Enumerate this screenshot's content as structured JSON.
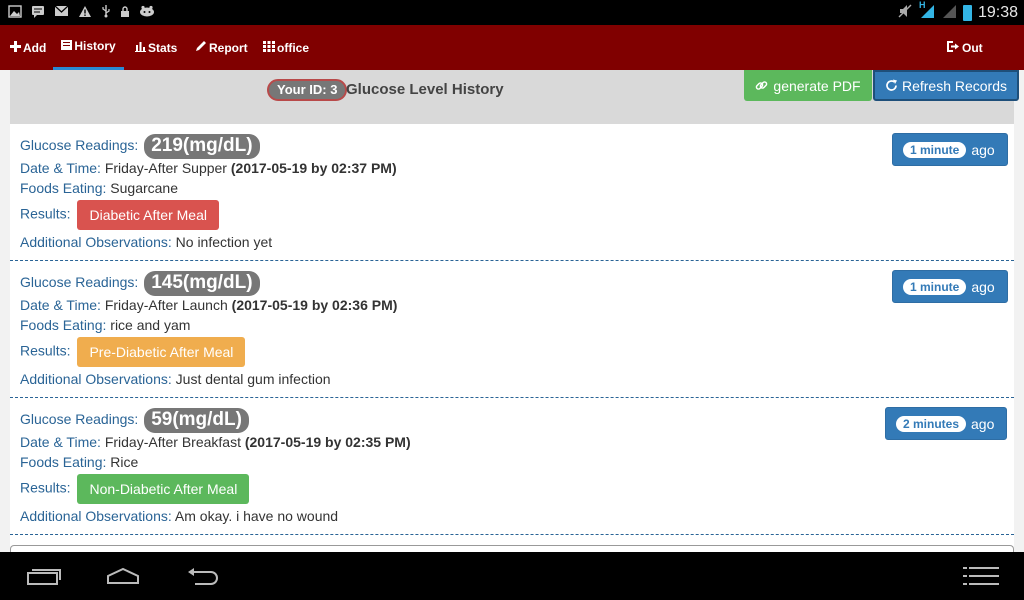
{
  "status_bar": {
    "icons_left": [
      "image-icon",
      "message-icon",
      "mail-icon",
      "warning-icon",
      "usb-icon",
      "lock-icon",
      "game-icon"
    ],
    "network": "H",
    "time": "19:38"
  },
  "nav": {
    "add": "Add",
    "history": "History",
    "stats": "Stats",
    "report": "Report",
    "office": "office",
    "out": "Out"
  },
  "header": {
    "id_badge": "Your ID: 3",
    "title": "Glucose Level History",
    "pdf_button": "generate PDF",
    "refresh_button": "Refresh Records"
  },
  "labels": {
    "glucose": "Glucose Readings:",
    "datetime": "Date & Time:",
    "foods": "Foods Eating:",
    "results": "Results:",
    "observations": "Additional Observations:",
    "ago": "ago"
  },
  "records": [
    {
      "reading": "219(mg/dL)",
      "meal": "Friday-After Supper",
      "datetime": "(2017-05-19 by 02:37 PM)",
      "foods": "Sugarcane",
      "result": "Diabetic After Meal",
      "observation": "No infection yet",
      "elapsed": "1 minute"
    },
    {
      "reading": "145(mg/dL)",
      "meal": "Friday-After Launch",
      "datetime": "(2017-05-19 by 02:36 PM)",
      "foods": "rice and yam",
      "result": "Pre-Diabetic After Meal",
      "observation": "Just dental gum infection",
      "elapsed": "1 minute"
    },
    {
      "reading": "59(mg/dL)",
      "meal": "Friday-After Breakfast",
      "datetime": "(2017-05-19 by 02:35 PM)",
      "foods": "Rice",
      "result": "Non-Diabetic After Meal",
      "observation": "Am okay. i have no wound",
      "elapsed": "2 minutes"
    }
  ],
  "colors": {
    "navbar": "#800000",
    "diabetic": "#d9534f",
    "pre_diabetic": "#f0ad4e",
    "non_diabetic": "#5cb85c",
    "primary": "#337ab7"
  }
}
